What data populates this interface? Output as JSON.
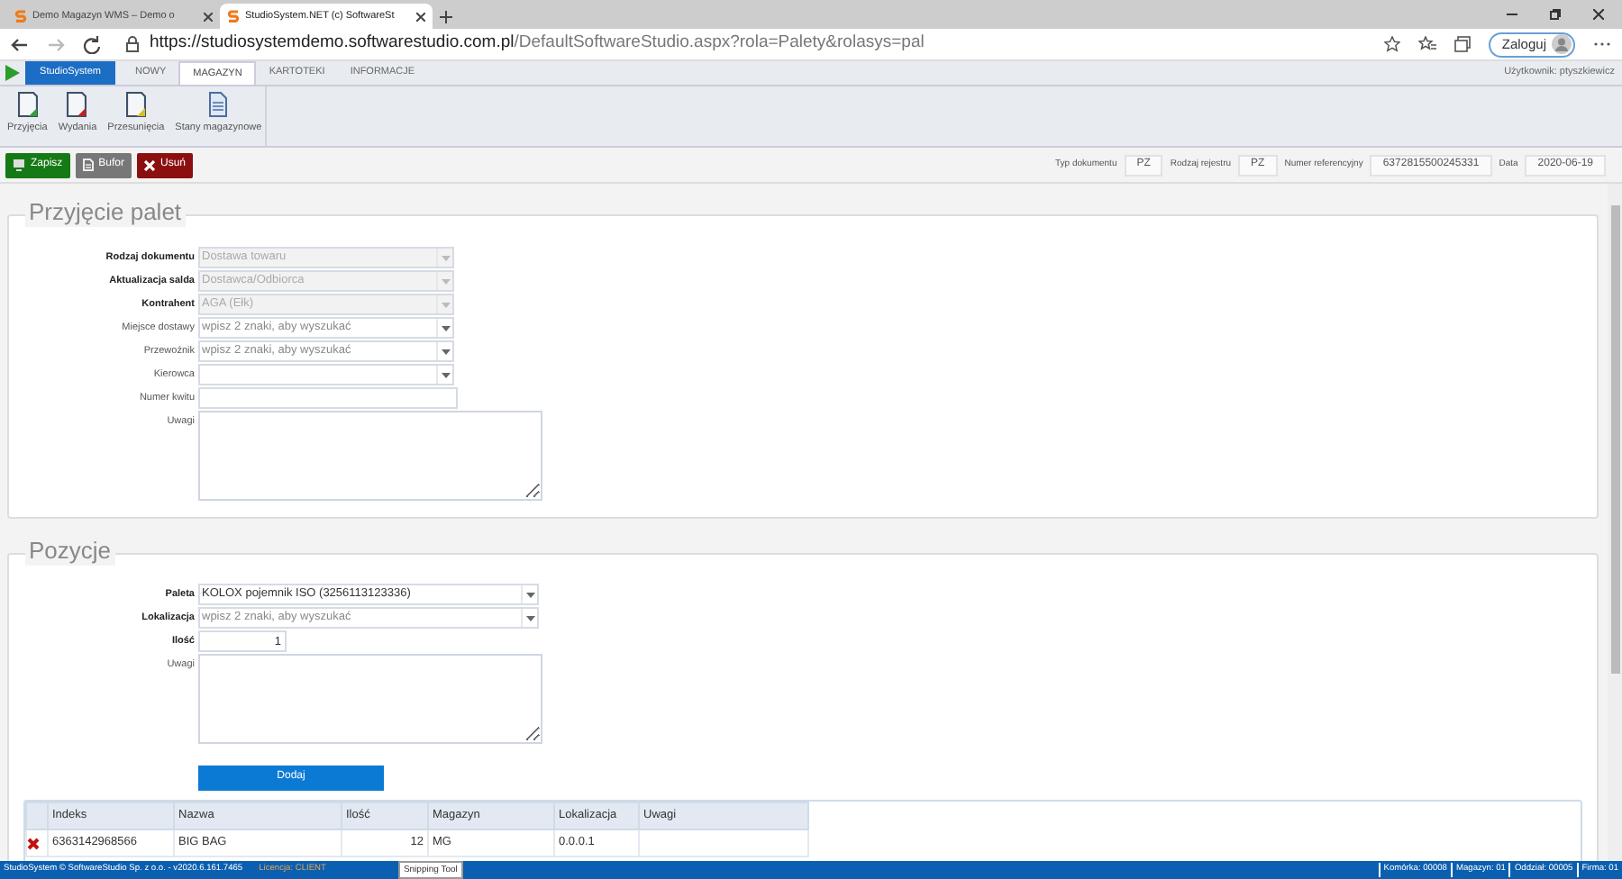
{
  "browser": {
    "tabs": [
      {
        "title": "Demo Magazyn WMS – Demo o",
        "selected": false
      },
      {
        "title": "StudioSystem.NET (c) SoftwareSt",
        "selected": true
      }
    ],
    "url": {
      "host": "https://studiosystemdemo.softwarestudio.com.pl",
      "path": "/DefaultSoftwareStudio.aspx?rola=Palety&rolasys=pal"
    },
    "login_button": "Zaloguj"
  },
  "app": {
    "brand": "StudioSystem",
    "menu_tabs": [
      {
        "label": "NOWY",
        "selected": false
      },
      {
        "label": "MAGAZYN",
        "selected": true
      },
      {
        "label": "KARTOTEKI",
        "selected": false
      },
      {
        "label": "INFORMACJE",
        "selected": false
      }
    ],
    "user": "Użytkownik: ptyszkiewicz",
    "ribbon": [
      {
        "label": "Przyjęcia",
        "kind": "in"
      },
      {
        "label": "Wydania",
        "kind": "out"
      },
      {
        "label": "Przesunięcia",
        "kind": "move"
      },
      {
        "label": "Stany magazynowe",
        "kind": "stock"
      }
    ]
  },
  "toolbar": {
    "buttons": [
      {
        "label": "Zapisz",
        "kind": "save"
      },
      {
        "label": "Bufor",
        "kind": "buffer"
      },
      {
        "label": "Usuń",
        "kind": "delete"
      }
    ],
    "info": [
      {
        "label": "Typ dokumentu",
        "value": "PZ"
      },
      {
        "label": "Rodzaj rejestru",
        "value": "PZ"
      },
      {
        "label": "Numer referencyjny",
        "value": "6372815500245331"
      },
      {
        "label": "Data",
        "value": "2020-06-19"
      }
    ]
  },
  "document": {
    "title": "Przyjęcie palet",
    "fields": [
      {
        "label": "Rodzaj dokumentu",
        "bold": true,
        "kind": "select",
        "value": "Dostawa towaru",
        "disabled": true
      },
      {
        "label": "Aktualizacja salda",
        "bold": true,
        "kind": "select",
        "value": "Dostawca/Odbiorca",
        "disabled": true
      },
      {
        "label": "Kontrahent",
        "bold": true,
        "kind": "select",
        "value": "AGA (Ełk)",
        "disabled": true
      },
      {
        "label": "Miejsce dostawy",
        "bold": false,
        "kind": "select",
        "placeholder": "wpisz 2 znaki, aby wyszukać",
        "disabled": false
      },
      {
        "label": "Przewoźnik",
        "bold": false,
        "kind": "select",
        "placeholder": "wpisz 2 znaki, aby wyszukać",
        "disabled": false
      },
      {
        "label": "Kierowca",
        "bold": false,
        "kind": "select",
        "disabled": false
      },
      {
        "label": "Numer kwitu",
        "bold": false,
        "kind": "text",
        "disabled": false
      },
      {
        "label": "Uwagi",
        "bold": false,
        "kind": "textarea",
        "disabled": false
      }
    ]
  },
  "positions": {
    "title": "Pozycje",
    "fields": [
      {
        "label": "Paleta",
        "bold": true,
        "kind": "select",
        "value": "KOLOX pojemnik ISO (3256113123336)",
        "disabled": false
      },
      {
        "label": "Lokalizacja",
        "bold": true,
        "kind": "select",
        "placeholder": "wpisz 2 znaki, aby wyszukać",
        "disabled": false
      },
      {
        "label": "Ilość",
        "bold": true,
        "kind": "number",
        "value": "1",
        "disabled": false
      },
      {
        "label": "Uwagi",
        "bold": false,
        "kind": "textarea",
        "disabled": false
      }
    ],
    "add_button": "Dodaj",
    "table": {
      "columns": [
        "Indeks",
        "Nazwa",
        "Ilość",
        "Magazyn",
        "Lokalizacja",
        "Uwagi"
      ],
      "rows": [
        {
          "cells": [
            "6363142968566",
            "BIG BAG",
            "12",
            "MG",
            "0.0.0.1",
            ""
          ]
        }
      ]
    }
  },
  "status_bar": {
    "left": "StudioSystem © SoftwareStudio Sp. z o.o. - v2020.6.161.7465",
    "license": "Licencja: CLIENT",
    "tooltip": "Snipping Tool",
    "right": [
      "Komórka: 00008",
      "Magazyn: 01",
      "Oddział: 00005",
      "Firma: 01"
    ]
  }
}
